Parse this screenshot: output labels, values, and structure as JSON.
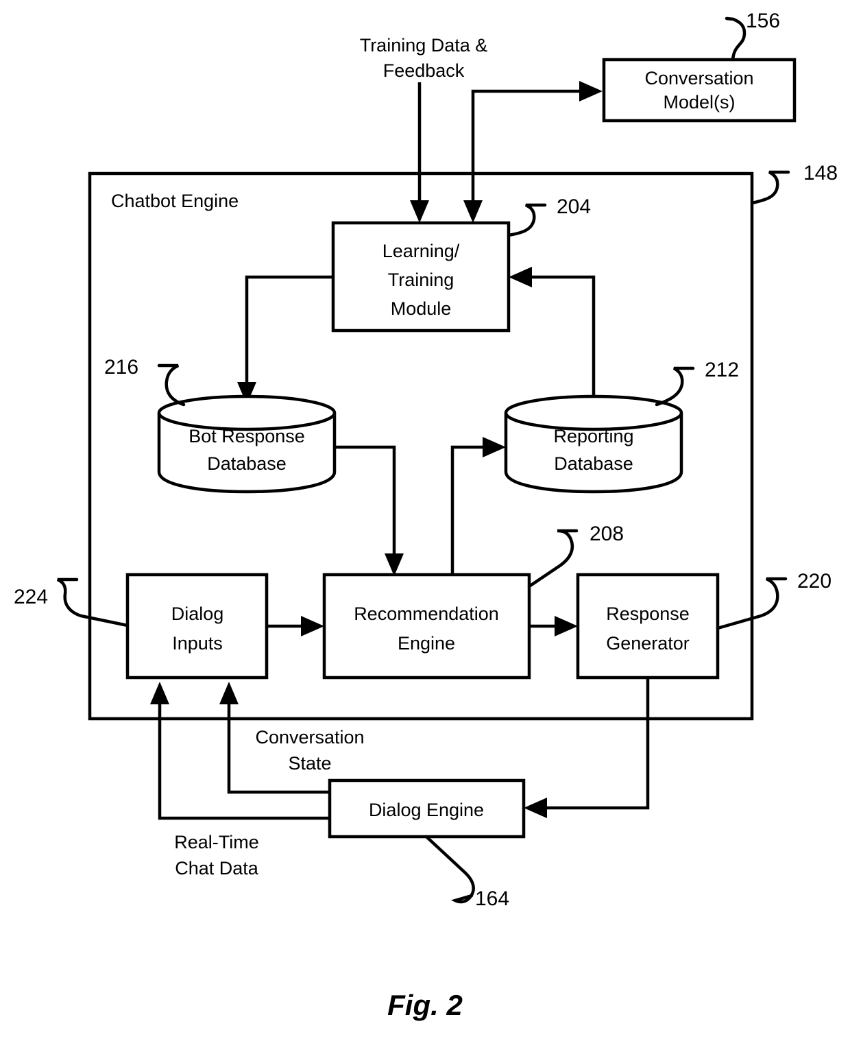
{
  "figure": {
    "caption": "Fig. 2",
    "container": {
      "label": "Chatbot Engine",
      "ref": "148"
    },
    "external_nodes": [
      {
        "id": "conversation-models",
        "label_line1": "Conversation",
        "label_line2": "Model(s)",
        "ref": "156"
      },
      {
        "id": "dialog-engine",
        "label_line1": "Dialog Engine",
        "label_line2": "",
        "ref": "164"
      }
    ],
    "internal_nodes": [
      {
        "id": "learning-training-module",
        "label_line1": "Learning/",
        "label_line2": "Training",
        "label_line3": "Module",
        "ref": "204"
      },
      {
        "id": "bot-response-database",
        "label_line1": "Bot Response",
        "label_line2": "Database",
        "ref": "216",
        "shape": "cylinder"
      },
      {
        "id": "reporting-database",
        "label_line1": "Reporting",
        "label_line2": "Database",
        "ref": "212",
        "shape": "cylinder"
      },
      {
        "id": "dialog-inputs",
        "label_line1": "Dialog",
        "label_line2": "Inputs",
        "ref": "224"
      },
      {
        "id": "recommendation-engine",
        "label_line1": "Recommendation",
        "label_line2": "Engine",
        "ref": "208"
      },
      {
        "id": "response-generator",
        "label_line1": "Response",
        "label_line2": "Generator",
        "ref": "220"
      }
    ],
    "flow_labels": [
      {
        "id": "training-data-feedback",
        "line1": "Training Data &",
        "line2": "Feedback"
      },
      {
        "id": "conversation-state",
        "line1": "Conversation",
        "line2": "State"
      },
      {
        "id": "real-time-chat-data",
        "line1": "Real-Time",
        "line2": "Chat Data"
      }
    ],
    "colors": {
      "stroke": "#000000",
      "fill": "#ffffff"
    }
  }
}
